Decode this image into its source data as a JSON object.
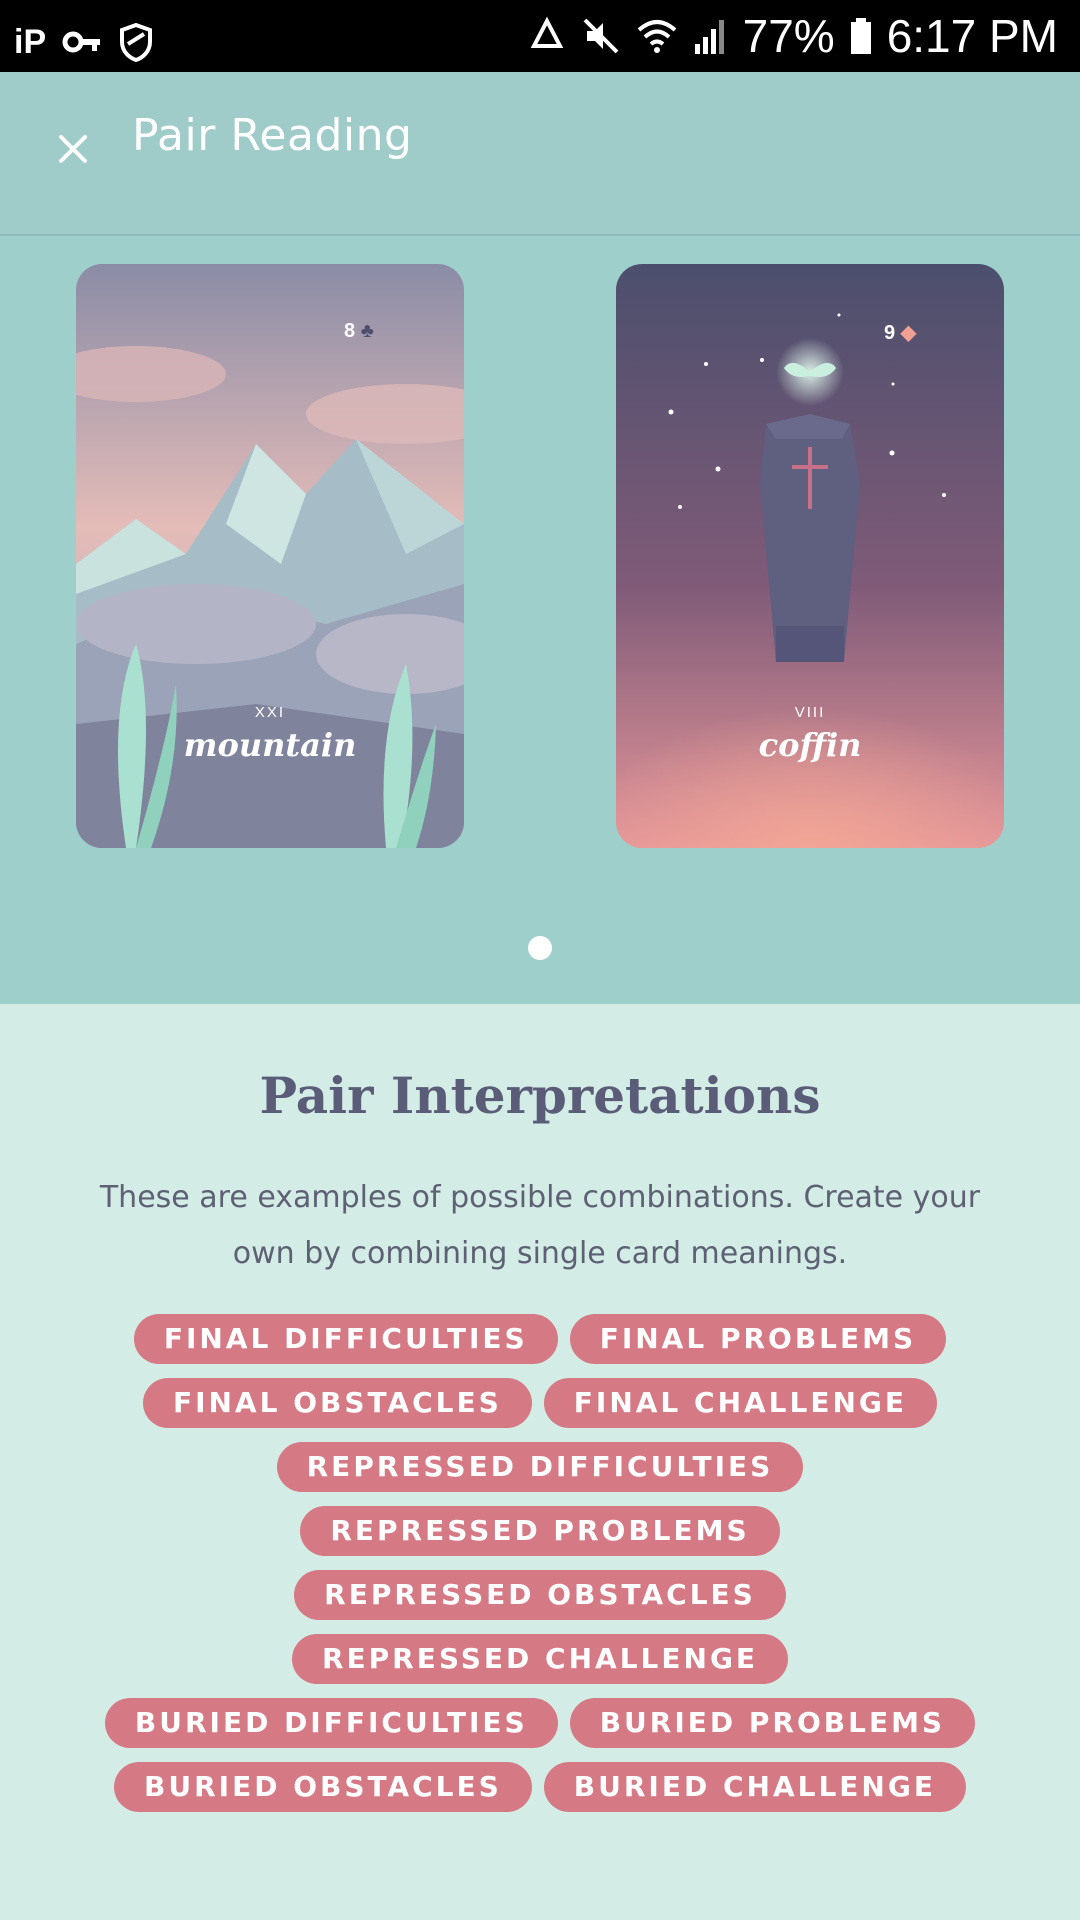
{
  "status_bar": {
    "battery": "77%",
    "time": "6:17 PM",
    "icons": [
      "ip-icon",
      "aperture-icon",
      "key-icon",
      "shield-icon",
      "recycle-icon",
      "mute-icon",
      "wifi-icon",
      "signal-icon",
      "battery-icon"
    ]
  },
  "header": {
    "close_icon": "close-icon",
    "title": "Pair Reading"
  },
  "cards": [
    {
      "number": "8",
      "suit": "♣",
      "roman": "XXI",
      "name": "mountain",
      "colors": {
        "top": "#8a8ca6",
        "mid": "#e4bcb8",
        "bottom": "#8f93a8"
      }
    },
    {
      "number": "9",
      "suit": "◆",
      "roman": "VIII",
      "name": "coffin",
      "colors": {
        "top": "#4b4f6d",
        "mid": "#7f5b78",
        "bottom": "#e5969a",
        "suit": "#f0a090"
      }
    }
  ],
  "carousel": {
    "pages": 1,
    "active": 1
  },
  "interpretations": {
    "title": "Pair Interpretations",
    "description": "These are examples of possible combinations. Create your own by combining single card meanings.",
    "chip_color": "#d57985",
    "rows": [
      [
        "FINAL DIFFICULTIES",
        "FINAL PROBLEMS"
      ],
      [
        "FINAL OBSTACLES",
        "FINAL CHALLENGE"
      ],
      [
        "REPRESSED DIFFICULTIES"
      ],
      [
        "REPRESSED PROBLEMS"
      ],
      [
        "REPRESSED OBSTACLES"
      ],
      [
        "REPRESSED CHALLENGE"
      ],
      [
        "BURIED DIFFICULTIES",
        "BURIED PROBLEMS"
      ],
      [
        "BURIED OBSTACLES",
        "BURIED CHALLENGE"
      ]
    ]
  }
}
